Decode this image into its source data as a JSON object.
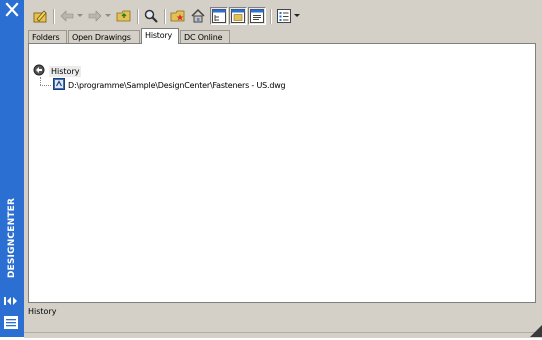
{
  "window": {
    "title": "DESIGNCENTER",
    "accent_color": "#2b6fd3",
    "frame_color": "#d4d0c8"
  },
  "sidebar": {
    "close_icon": "close-icon",
    "autohide_icon": "autohide-arrows-icon",
    "properties_icon": "properties-icon"
  },
  "toolbar": {
    "items": [
      {
        "name": "load",
        "icon": "load-pencil-icon"
      },
      {
        "name": "back",
        "icon": "back-arrow-icon"
      },
      {
        "name": "forward",
        "icon": "forward-arrow-icon"
      },
      {
        "name": "up",
        "icon": "up-folder-icon"
      },
      {
        "name": "search",
        "icon": "search-icon"
      },
      {
        "name": "favorites",
        "icon": "favorites-icon"
      },
      {
        "name": "home",
        "icon": "home-icon"
      },
      {
        "name": "tree-view-toggle",
        "icon": "tree-view-icon",
        "pressed": true
      },
      {
        "name": "preview",
        "icon": "preview-icon",
        "pressed": true
      },
      {
        "name": "description",
        "icon": "description-icon",
        "pressed": true
      },
      {
        "name": "views",
        "icon": "views-icon"
      }
    ]
  },
  "tabs": [
    {
      "label": "Folders"
    },
    {
      "label": "Open Drawings"
    },
    {
      "label": "History",
      "active": true
    },
    {
      "label": "DC Online"
    }
  ],
  "tree": {
    "root_label": "History",
    "children": [
      {
        "label": "D:\\programme\\Sample\\DesignCenter\\Fasteners - US.dwg"
      }
    ]
  },
  "status_bar": {
    "text": "History"
  }
}
